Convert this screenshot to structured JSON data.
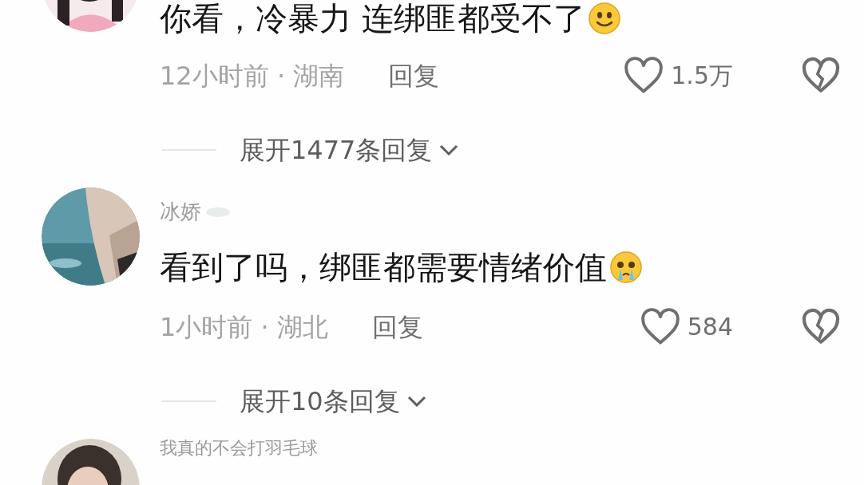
{
  "comments": [
    {
      "text": "你看，冷暴力 连绑匪都受不了",
      "emoji": {
        "kind": "smile"
      },
      "meta": "12小时前 · 湖南",
      "reply": "回复",
      "likes": "1.5万",
      "expand": "展开1477条回复"
    },
    {
      "name": "冰娇",
      "text": "看到了吗，绑匪都需要情绪价值",
      "emoji": {
        "kind": "cry"
      },
      "meta": "1小时前 · 湖北",
      "reply": "回复",
      "likes": "584",
      "expand": "展开10条回复"
    },
    {
      "name": "我真的不会打羽毛球"
    }
  ]
}
